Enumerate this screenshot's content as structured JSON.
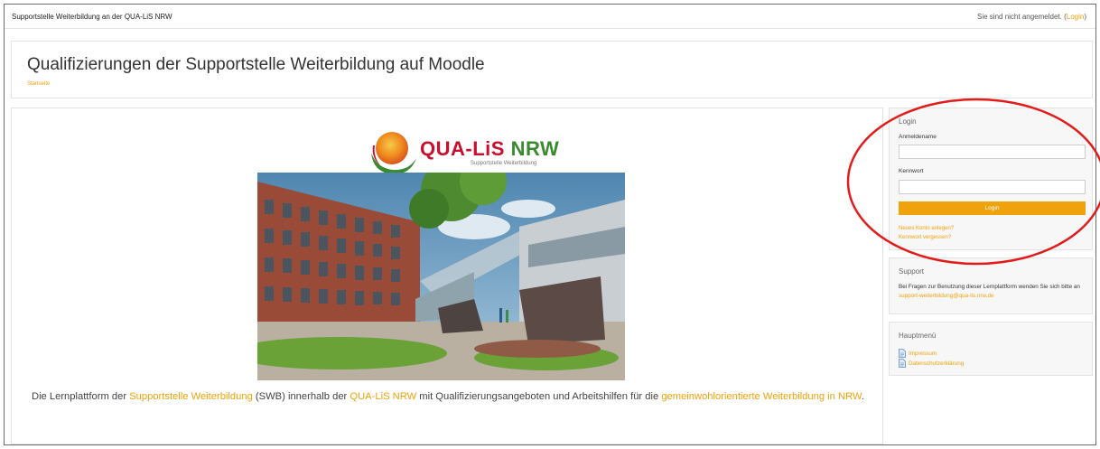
{
  "navbar": {
    "site_name": "Supportstelle Weiterbildung an der QUA-LiS NRW",
    "login_status": "Sie sind nicht angemeldet. (",
    "login_link": "Login",
    "login_status_end": ")"
  },
  "header": {
    "title": "Qualifizierungen der Supportstelle Weiterbildung auf Moodle",
    "breadcrumb": "Startseite"
  },
  "main": {
    "logo": {
      "name_part1": "QUA-LiS ",
      "name_part2": "NRW",
      "subtitle": "Supportstelle Weiterbildung"
    },
    "intro": {
      "text1": "Die Lernplattform der ",
      "link1": "Supportstelle Weiterbildung",
      "text2": " (SWB) innerhalb der ",
      "link2": "QUA-LiS NRW",
      "text3": " mit Qualifizierungsangeboten und Arbeitshilfen für die ",
      "link3": "gemeinwohlorientierte Weiterbildung in NRW",
      "text4": "."
    }
  },
  "login_block": {
    "title": "Login",
    "username_label": "Anmeldename",
    "username_value": "",
    "password_label": "Kennwort",
    "password_value": "",
    "login_button": "Login",
    "new_account_link": "Neues Konto anlegen?",
    "forgot_password_link": "Kennwort vergessen?"
  },
  "support_block": {
    "title": "Support",
    "text": "Bei Fragen zur Benutzung dieser Lernplattform wenden Sie sich bitte an ",
    "email": "support-weiterbildung@qua-lis.nrw.de"
  },
  "menu_block": {
    "title": "Hauptmenü",
    "items": [
      {
        "label": "Impressum",
        "icon": "document-icon"
      },
      {
        "label": "Datenschutzerklärung",
        "icon": "document-icon"
      }
    ]
  },
  "colors": {
    "accent": "#f0a20c",
    "annotation": "#e21b1b",
    "logo_red": "#c8102e",
    "logo_green": "#3a8a2f"
  }
}
